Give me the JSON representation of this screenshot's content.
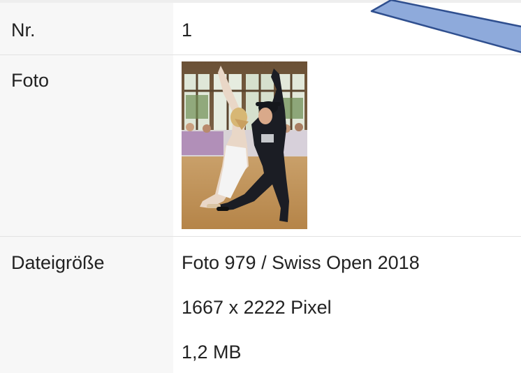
{
  "details_table": {
    "rows": [
      {
        "label": "Nr.",
        "value": "1"
      },
      {
        "label": "Foto",
        "photo_alt": "Foto",
        "photo_icon": "dancing-couple-photo"
      },
      {
        "label": "Dateigröße",
        "lines": [
          "Foto 979 / Swiss Open 2018",
          "1667 x 2222 Pixel",
          "1,2 MB"
        ]
      }
    ]
  },
  "colors": {
    "label_bg": "#f7f7f7",
    "row_divider": "#e2e2e2",
    "text": "#222222",
    "arrow_fill": "#8eaadb",
    "arrow_stroke": "#2f4f8f"
  }
}
